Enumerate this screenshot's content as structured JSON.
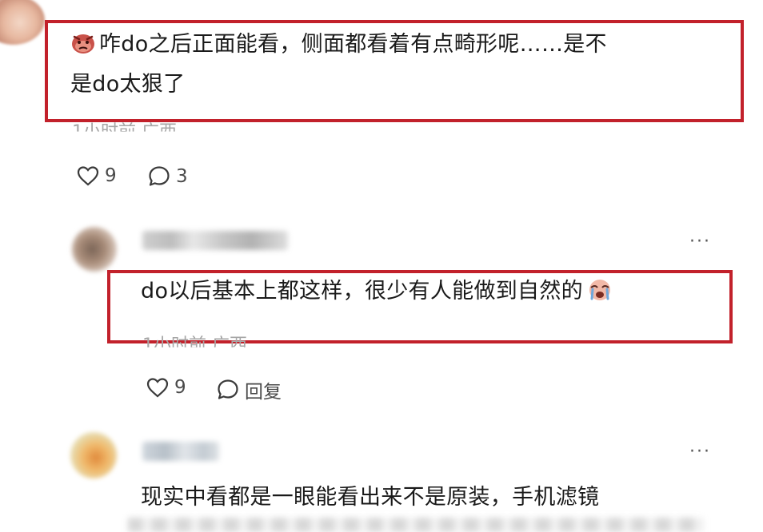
{
  "comment_top": {
    "text_line1": "咋do之后正面能看，侧面都看着有点畸形呢……是不",
    "text_line2": "是do太狠了",
    "meta": "1小时前 广西",
    "likes": "9",
    "replies": "3",
    "emoji_icon": "angry-face-icon"
  },
  "reply": {
    "text": "do以后基本上都这样，很少有人能做到自然的",
    "meta": "1小时前 广西",
    "likes": "9",
    "reply_label": "回复",
    "more_label": "···",
    "emoji_icon": "crying-face-icon"
  },
  "comment_third": {
    "text": "现实中看都是一眼能看出来不是原装，手机滤镜",
    "more_label": "···"
  },
  "colors": {
    "highlight": "#c2212b",
    "meta_gray": "#a6a6a6"
  }
}
